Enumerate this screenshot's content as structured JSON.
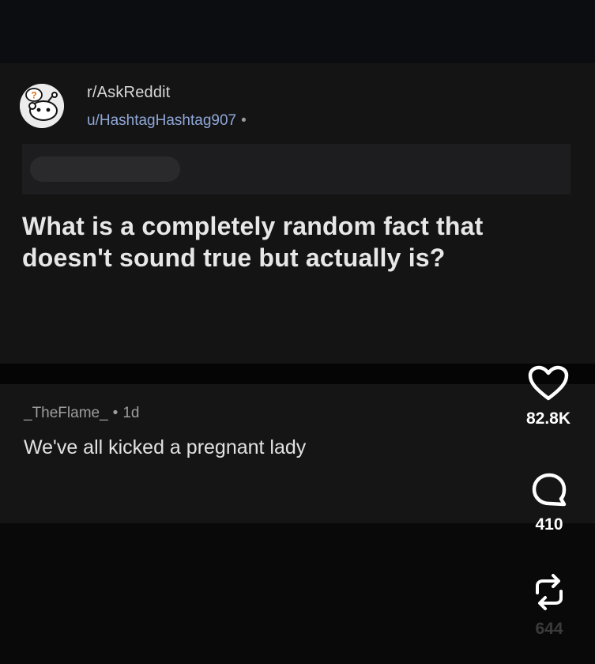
{
  "post": {
    "subreddit": "r/AskReddit",
    "author": "u/HashtagHashtag907",
    "author_suffix": "•",
    "title": "What is a completely random fact that doesn't sound true but actually is?"
  },
  "comment": {
    "username": "_TheFlame_",
    "separator": "•",
    "age": "1d",
    "body": "We've all kicked a pregnant lady"
  },
  "actions": {
    "like_count": "82.8K",
    "comment_count": "410",
    "share_count": "644"
  },
  "icons": {
    "avatar": "reddit-askreddit-snoo-icon",
    "like": "heart-icon",
    "comment": "speech-bubble-icon",
    "share": "repost-arrows-icon"
  },
  "colors": {
    "author_link": "#8fa7d6",
    "background": "#0a0a0b"
  }
}
